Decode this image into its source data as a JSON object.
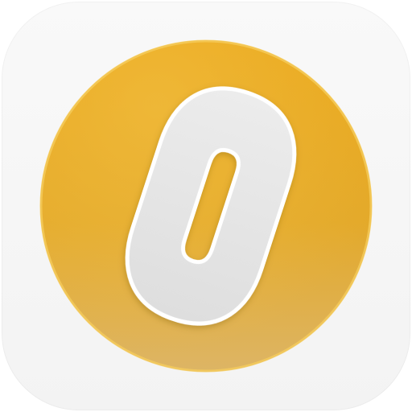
{
  "app_icon": {
    "name": "coin-zero-app-icon",
    "glyph": "0",
    "colors": {
      "tile_background": "#f4f4f4",
      "coin_top": "#e8a91f",
      "coin_bottom": "#e0b456",
      "coin_rim": "#f3c650",
      "glyph_fill": "#e6e6e6",
      "glyph_outline": "#ffffff"
    }
  }
}
